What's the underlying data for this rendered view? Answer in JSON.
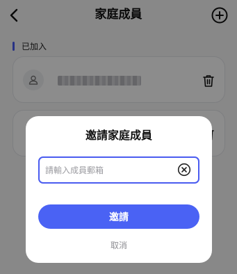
{
  "header": {
    "title": "家庭成員",
    "back_icon": "chevron-left-icon",
    "add_icon": "plus-circle-icon"
  },
  "section": {
    "label": "已加入",
    "accent_color": "#4a5cf0"
  },
  "members": [
    {
      "name": "xxxxxxxxxxxxxxxxxxx",
      "avatar_icon": "user-icon",
      "action_icon": "trash-icon"
    },
    {
      "name": "",
      "avatar_icon": "user-icon",
      "action_icon": "trash-icon"
    }
  ],
  "dialog": {
    "title": "邀請家庭成員",
    "email_input": {
      "value": "",
      "placeholder": "請輸入成員郵箱",
      "clear_icon": "clear-circle-icon"
    },
    "invite_label": "邀請",
    "cancel_label": "取消",
    "primary_color": "#4a62f4"
  }
}
